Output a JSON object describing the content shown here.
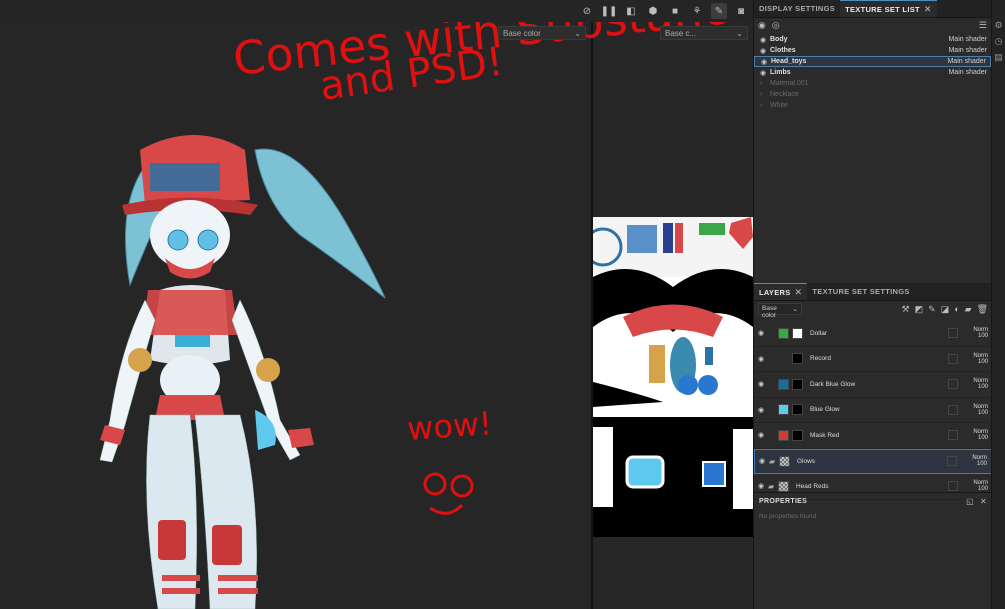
{
  "viewport": {
    "channel_3d": "Base color",
    "channel_2d": "Base c..."
  },
  "toolbar": {
    "icons": [
      "camera-off-icon",
      "pause-icon",
      "cube-icon",
      "box-icon",
      "video-camera-icon",
      "render-icon",
      "paint-brush-icon",
      "screenshot-icon"
    ]
  },
  "panel_tabs": {
    "display_settings": "DISPLAY SETTINGS",
    "texture_set_list": "TEXTURE SET LIST"
  },
  "texture_sets": [
    {
      "name": "Body",
      "shader": "Main shader",
      "state": "visible"
    },
    {
      "name": "Clothes",
      "shader": "Main shader",
      "state": "visible"
    },
    {
      "name": "Head_toys",
      "shader": "Main shader",
      "state": "selected"
    },
    {
      "name": "Limbs",
      "shader": "Main shader",
      "state": "visible"
    },
    {
      "name": "Material.001",
      "shader": "",
      "state": "collapsed"
    },
    {
      "name": "Necklace",
      "shader": "",
      "state": "collapsed"
    },
    {
      "name": "White",
      "shader": "",
      "state": "collapsed"
    }
  ],
  "layers_tabs": {
    "layers": "LAYERS",
    "texture_set_settings": "TEXTURE SET SETTINGS"
  },
  "layers_channel": "Base color",
  "layers": [
    {
      "name": "Dollar",
      "blend": "Norm",
      "opacity": "100",
      "color": "#3aa84a",
      "mask": "white",
      "folder": false,
      "selected": false
    },
    {
      "name": "Record",
      "blend": "Norm",
      "opacity": "100",
      "color": "",
      "mask": "black",
      "folder": false,
      "selected": false
    },
    {
      "name": "Dark Blue Glow",
      "blend": "Norm",
      "opacity": "100",
      "color": "#1a6f9a",
      "mask": "black",
      "folder": false,
      "selected": false
    },
    {
      "name": "Blue Glow",
      "blend": "Norm",
      "opacity": "100",
      "color": "#5ec8ee",
      "mask": "black",
      "folder": false,
      "selected": false
    },
    {
      "name": "Mask Red",
      "blend": "Norm",
      "opacity": "100",
      "color": "#d03a3a",
      "mask": "black",
      "folder": false,
      "selected": false
    },
    {
      "name": "Glows",
      "blend": "Norm",
      "opacity": "100",
      "color": "checker",
      "mask": "",
      "folder": true,
      "selected": true
    },
    {
      "name": "Head Reds",
      "blend": "Norm",
      "opacity": "100",
      "color": "checker",
      "mask": "",
      "folder": true,
      "selected": false
    }
  ],
  "properties": {
    "title": "PROPERTIES",
    "empty_text": "No properties found"
  },
  "annotations": {
    "line1": "Comes with Substance",
    "line2": "and PSD!",
    "line3": "wow!",
    "color": "#e01010"
  }
}
